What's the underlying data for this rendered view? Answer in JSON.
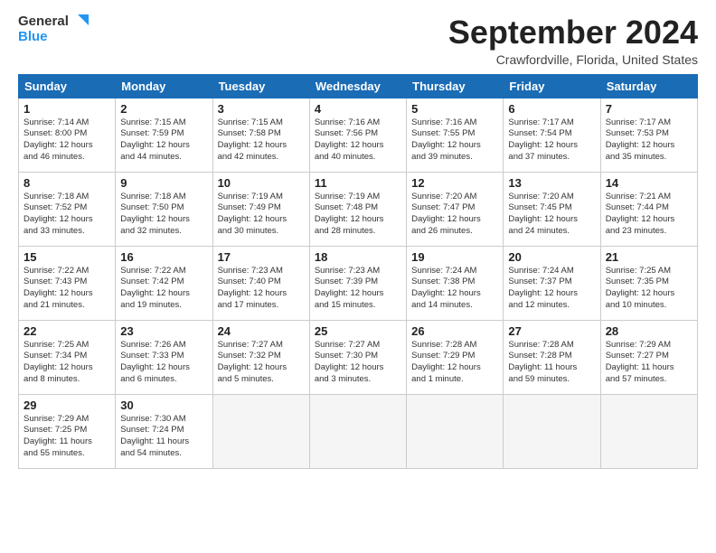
{
  "logo": {
    "line1": "General",
    "line2": "Blue"
  },
  "title": "September 2024",
  "location": "Crawfordville, Florida, United States",
  "days_of_week": [
    "Sunday",
    "Monday",
    "Tuesday",
    "Wednesday",
    "Thursday",
    "Friday",
    "Saturday"
  ],
  "weeks": [
    [
      {
        "day": "1",
        "sunrise": "7:14 AM",
        "sunset": "8:00 PM",
        "daylight": "12 hours and 46 minutes."
      },
      {
        "day": "2",
        "sunrise": "7:15 AM",
        "sunset": "7:59 PM",
        "daylight": "12 hours and 44 minutes."
      },
      {
        "day": "3",
        "sunrise": "7:15 AM",
        "sunset": "7:58 PM",
        "daylight": "12 hours and 42 minutes."
      },
      {
        "day": "4",
        "sunrise": "7:16 AM",
        "sunset": "7:56 PM",
        "daylight": "12 hours and 40 minutes."
      },
      {
        "day": "5",
        "sunrise": "7:16 AM",
        "sunset": "7:55 PM",
        "daylight": "12 hours and 39 minutes."
      },
      {
        "day": "6",
        "sunrise": "7:17 AM",
        "sunset": "7:54 PM",
        "daylight": "12 hours and 37 minutes."
      },
      {
        "day": "7",
        "sunrise": "7:17 AM",
        "sunset": "7:53 PM",
        "daylight": "12 hours and 35 minutes."
      }
    ],
    [
      {
        "day": "8",
        "sunrise": "7:18 AM",
        "sunset": "7:52 PM",
        "daylight": "12 hours and 33 minutes."
      },
      {
        "day": "9",
        "sunrise": "7:18 AM",
        "sunset": "7:50 PM",
        "daylight": "12 hours and 32 minutes."
      },
      {
        "day": "10",
        "sunrise": "7:19 AM",
        "sunset": "7:49 PM",
        "daylight": "12 hours and 30 minutes."
      },
      {
        "day": "11",
        "sunrise": "7:19 AM",
        "sunset": "7:48 PM",
        "daylight": "12 hours and 28 minutes."
      },
      {
        "day": "12",
        "sunrise": "7:20 AM",
        "sunset": "7:47 PM",
        "daylight": "12 hours and 26 minutes."
      },
      {
        "day": "13",
        "sunrise": "7:20 AM",
        "sunset": "7:45 PM",
        "daylight": "12 hours and 24 minutes."
      },
      {
        "day": "14",
        "sunrise": "7:21 AM",
        "sunset": "7:44 PM",
        "daylight": "12 hours and 23 minutes."
      }
    ],
    [
      {
        "day": "15",
        "sunrise": "7:22 AM",
        "sunset": "7:43 PM",
        "daylight": "12 hours and 21 minutes."
      },
      {
        "day": "16",
        "sunrise": "7:22 AM",
        "sunset": "7:42 PM",
        "daylight": "12 hours and 19 minutes."
      },
      {
        "day": "17",
        "sunrise": "7:23 AM",
        "sunset": "7:40 PM",
        "daylight": "12 hours and 17 minutes."
      },
      {
        "day": "18",
        "sunrise": "7:23 AM",
        "sunset": "7:39 PM",
        "daylight": "12 hours and 15 minutes."
      },
      {
        "day": "19",
        "sunrise": "7:24 AM",
        "sunset": "7:38 PM",
        "daylight": "12 hours and 14 minutes."
      },
      {
        "day": "20",
        "sunrise": "7:24 AM",
        "sunset": "7:37 PM",
        "daylight": "12 hours and 12 minutes."
      },
      {
        "day": "21",
        "sunrise": "7:25 AM",
        "sunset": "7:35 PM",
        "daylight": "12 hours and 10 minutes."
      }
    ],
    [
      {
        "day": "22",
        "sunrise": "7:25 AM",
        "sunset": "7:34 PM",
        "daylight": "12 hours and 8 minutes."
      },
      {
        "day": "23",
        "sunrise": "7:26 AM",
        "sunset": "7:33 PM",
        "daylight": "12 hours and 6 minutes."
      },
      {
        "day": "24",
        "sunrise": "7:27 AM",
        "sunset": "7:32 PM",
        "daylight": "12 hours and 5 minutes."
      },
      {
        "day": "25",
        "sunrise": "7:27 AM",
        "sunset": "7:30 PM",
        "daylight": "12 hours and 3 minutes."
      },
      {
        "day": "26",
        "sunrise": "7:28 AM",
        "sunset": "7:29 PM",
        "daylight": "12 hours and 1 minute."
      },
      {
        "day": "27",
        "sunrise": "7:28 AM",
        "sunset": "7:28 PM",
        "daylight": "11 hours and 59 minutes."
      },
      {
        "day": "28",
        "sunrise": "7:29 AM",
        "sunset": "7:27 PM",
        "daylight": "11 hours and 57 minutes."
      }
    ],
    [
      {
        "day": "29",
        "sunrise": "7:29 AM",
        "sunset": "7:25 PM",
        "daylight": "11 hours and 55 minutes."
      },
      {
        "day": "30",
        "sunrise": "7:30 AM",
        "sunset": "7:24 PM",
        "daylight": "11 hours and 54 minutes."
      },
      null,
      null,
      null,
      null,
      null
    ]
  ]
}
